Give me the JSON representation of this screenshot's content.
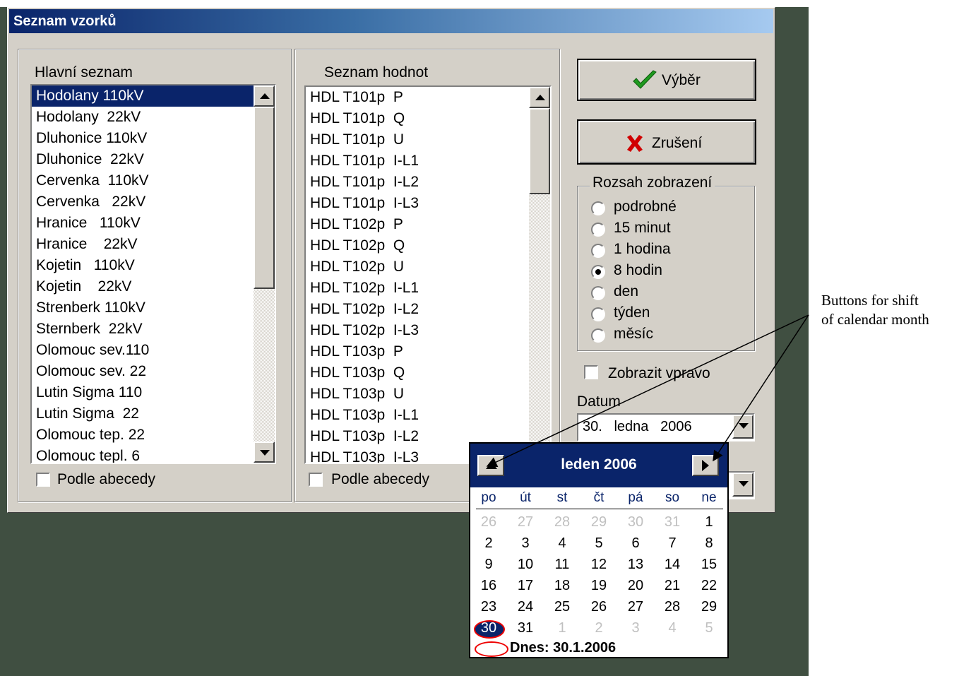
{
  "window": {
    "title": "Seznam vzorků"
  },
  "main_list": {
    "label": "Hlavní seznam",
    "items": [
      "Hodolany 110kV",
      "Hodolany  22kV",
      "Dluhonice 110kV",
      "Dluhonice  22kV",
      "Cervenka  110kV",
      "Cervenka   22kV",
      "Hranice   110kV",
      "Hranice    22kV",
      "Kojetin   110kV",
      "Kojetin    22kV",
      "Strenberk 110kV",
      "Sternberk  22kV",
      "Olomouc sev.110",
      "Olomouc sev. 22",
      "Lutin Sigma 110",
      "Lutin Sigma  22",
      "Olomouc tep. 22",
      "Olomouc tepl. 6"
    ],
    "selected_index": 0,
    "sort_label": "Podle abecedy"
  },
  "value_list": {
    "label": "Seznam hodnot",
    "items": [
      "HDL T101p  P",
      "HDL T101p  Q",
      "HDL T101p  U",
      "HDL T101p  I-L1",
      "HDL T101p  I-L2",
      "HDL T101p  I-L3",
      "HDL T102p  P",
      "HDL T102p  Q",
      "HDL T102p  U",
      "HDL T102p  I-L1",
      "HDL T102p  I-L2",
      "HDL T102p  I-L3",
      "HDL T103p  P",
      "HDL T103p  Q",
      "HDL T103p  U",
      "HDL T103p  I-L1",
      "HDL T103p  I-L2",
      "HDL T103p  I-L3"
    ],
    "sort_label": "Podle abecedy"
  },
  "buttons": {
    "select_label": "Výběr",
    "cancel_label": "Zrušení"
  },
  "range": {
    "label": "Rozsah zobrazení",
    "options": [
      "podrobné",
      "15 minut",
      "1 hodina",
      "8 hodin",
      "den",
      "týden",
      "měsíc"
    ],
    "selected": "8 hodin"
  },
  "show_right_label": "Zobrazit vpravo",
  "date": {
    "label": "Datum",
    "value": "30.   ledna   2006"
  },
  "calendar": {
    "title": "leden 2006",
    "weekdays": [
      "po",
      "út",
      "st",
      "čt",
      "pá",
      "so",
      "ne"
    ],
    "weeks": [
      [
        "26",
        "27",
        "28",
        "29",
        "30",
        "31",
        "1"
      ],
      [
        "2",
        "3",
        "4",
        "5",
        "6",
        "7",
        "8"
      ],
      [
        "9",
        "10",
        "11",
        "12",
        "13",
        "14",
        "15"
      ],
      [
        "16",
        "17",
        "18",
        "19",
        "20",
        "21",
        "22"
      ],
      [
        "23",
        "24",
        "25",
        "26",
        "27",
        "28",
        "29"
      ],
      [
        "30",
        "31",
        "1",
        "2",
        "3",
        "4",
        "5"
      ]
    ],
    "today_label": "Dnes: 30.1.2006"
  },
  "annotation": {
    "line1": "Buttons for shift",
    "line2": "of calendar month"
  },
  "colors": {
    "desktop": "#404f41",
    "dialog": "#d4d0c8",
    "selection": "#0a246a",
    "annotation_circle": "#e00000"
  }
}
